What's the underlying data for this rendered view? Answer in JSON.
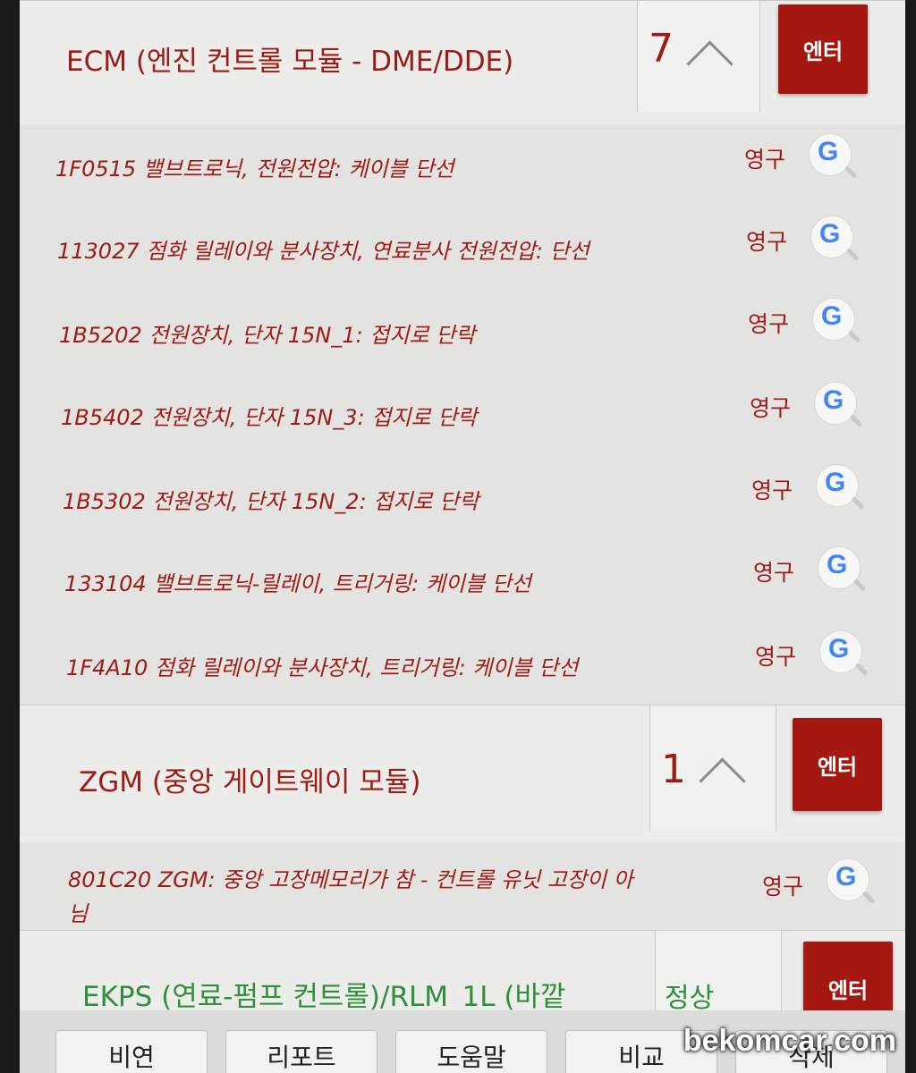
{
  "modules": [
    {
      "title": "ECM (엔진 컨트롤 모듈 - DME/DDE)",
      "count": "7",
      "enter_label": "엔터",
      "faults": [
        {
          "text": "1F0515 밸브트로닉, 전원전압: 케이블 단선",
          "status": "영구"
        },
        {
          "text": "113027 점화 릴레이와 분사장치, 연료분사 전원전압: 단선",
          "status": "영구"
        },
        {
          "text": "1B5202 전원장치, 단자 15N_1: 접지로 단락",
          "status": "영구"
        },
        {
          "text": "1B5402 전원장치, 단자 15N_3: 접지로 단락",
          "status": "영구"
        },
        {
          "text": "1B5302 전원장치, 단자 15N_2: 접지로 단락",
          "status": "영구"
        },
        {
          "text": "133104 밸브트로닉-릴레이, 트리거링: 케이블 단선",
          "status": "영구"
        },
        {
          "text": "1F4A10 점화 릴레이와 분사장치, 트리거링: 케이블 단선",
          "status": "영구"
        }
      ]
    },
    {
      "title": "ZGM (중앙 게이트웨이 모듈)",
      "count": "1",
      "enter_label": "엔터",
      "faults": [
        {
          "line1": "801C20 ZGM: 중앙 고장메모리가 참 - 컨트롤 유닛 고장이 아",
          "line2": "님",
          "status": "영구"
        }
      ]
    },
    {
      "title": "EKPS (연료-펌프 컨트롤)/RLM_1L (바깥",
      "status": "정상",
      "enter_label": "엔터"
    }
  ],
  "bottom_tabs": [
    "비연",
    "리포트",
    "도움말",
    "비교",
    "삭제"
  ],
  "watermark": "bekomcar.com",
  "icons": {
    "search": "google-search-icon",
    "chevron": "chevron-up-icon"
  },
  "colors": {
    "accent": "#a51812",
    "text_red": "#9c1b14",
    "text_green": "#2f8f3a"
  }
}
